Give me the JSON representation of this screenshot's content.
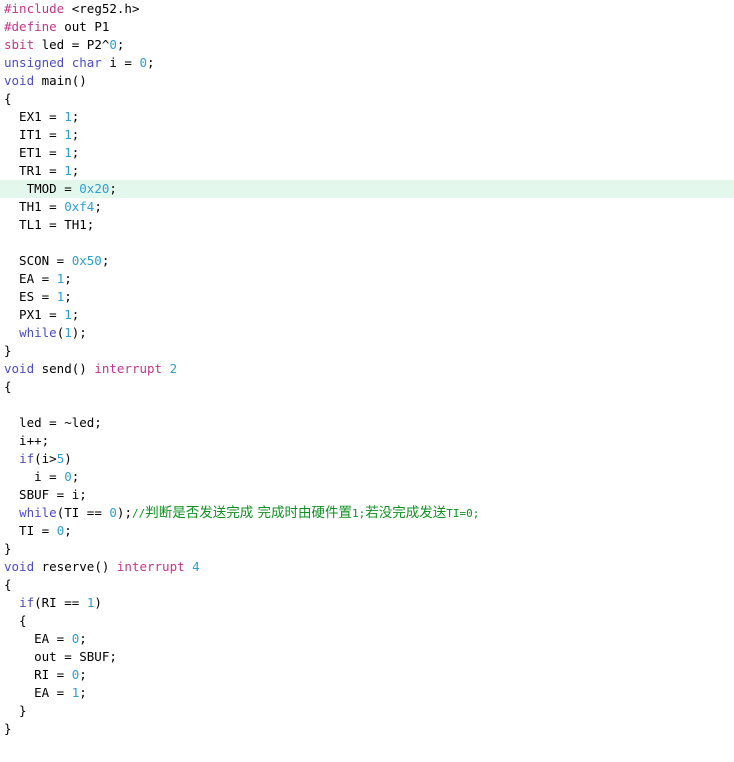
{
  "editor": {
    "language": "c",
    "background_color": "#ffffff",
    "default_text_color": "#000000",
    "highlight_color": "#e4f7ec",
    "highlighted_line_number": 12,
    "token_colors": {
      "preprocessor": "#c4368a",
      "keyword": "#4b4bc8",
      "number": "#2c9fd0",
      "comment": "#0f9020",
      "plain": "#000000"
    }
  },
  "lines": [
    {
      "n": 1,
      "text": "#include <reg52.h>"
    },
    {
      "n": 2,
      "text": "#define out P1"
    },
    {
      "n": 3,
      "text": "sbit led = P2^0;"
    },
    {
      "n": 4,
      "text": "unsigned char i = 0;"
    },
    {
      "n": 5,
      "text": "void main()"
    },
    {
      "n": 6,
      "text": "{"
    },
    {
      "n": 7,
      "text": "  EX1 = 1;"
    },
    {
      "n": 8,
      "text": "  IT1 = 1;"
    },
    {
      "n": 9,
      "text": "  ET1 = 1;"
    },
    {
      "n": 10,
      "text": "  TR1 = 1;"
    },
    {
      "n": 11,
      "text": "   TMOD = 0x20;"
    },
    {
      "n": 12,
      "text": "  TH1 = 0xf4;"
    },
    {
      "n": 13,
      "text": "  TL1 = TH1;"
    },
    {
      "n": 14,
      "text": ""
    },
    {
      "n": 15,
      "text": "  SCON = 0x50;"
    },
    {
      "n": 16,
      "text": "  EA = 1;"
    },
    {
      "n": 17,
      "text": "  ES = 1;"
    },
    {
      "n": 18,
      "text": "  PX1 = 1;"
    },
    {
      "n": 19,
      "text": "  while(1);"
    },
    {
      "n": 20,
      "text": "}"
    },
    {
      "n": 21,
      "text": "void send() interrupt 2"
    },
    {
      "n": 22,
      "text": "{"
    },
    {
      "n": 23,
      "text": ""
    },
    {
      "n": 24,
      "text": "  led = ~led;"
    },
    {
      "n": 25,
      "text": "  i++;"
    },
    {
      "n": 26,
      "text": "  if(i>5)"
    },
    {
      "n": 27,
      "text": "    i = 0;"
    },
    {
      "n": 28,
      "text": "  SBUF = i;"
    },
    {
      "n": 29,
      "text": "  while(TI == 0);//判断是否发送完成 完成时由硬件置1;若没完成发送TI=0;"
    },
    {
      "n": 30,
      "text": "  TI = 0;"
    },
    {
      "n": 31,
      "text": "}"
    },
    {
      "n": 32,
      "text": "void reserve() interrupt 4"
    },
    {
      "n": 33,
      "text": "{"
    },
    {
      "n": 34,
      "text": "  if(RI == 1)"
    },
    {
      "n": 35,
      "text": "  {"
    },
    {
      "n": 36,
      "text": "    EA = 0;"
    },
    {
      "n": 37,
      "text": "    out = SBUF;"
    },
    {
      "n": 38,
      "text": "    RI = 0;"
    },
    {
      "n": 39,
      "text": "    EA = 1;"
    },
    {
      "n": 40,
      "text": "  }"
    },
    {
      "n": 41,
      "text": "}"
    }
  ],
  "comment_text": "//判断是否发送完成 完成时由硬件置1;若没完成发送TI=0;"
}
